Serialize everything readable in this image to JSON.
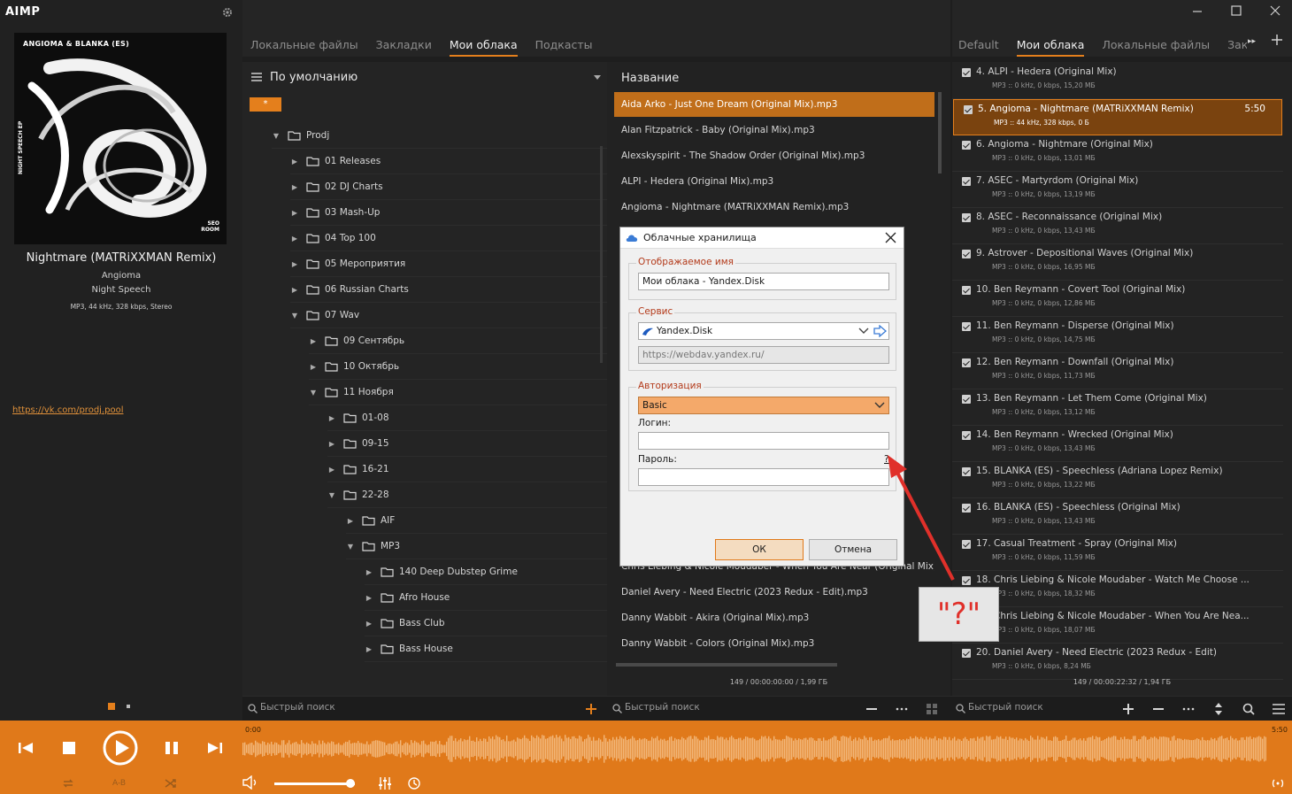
{
  "app": {
    "logo": "AIMP"
  },
  "now_playing": {
    "cover_caption": "ANGIOMA & BLANKA (ES)",
    "cover_side_text": "NIGHT SPEECH EP",
    "cover_label": "SEO ROOM",
    "title": "Nightmare (MATRiXXMAN Remix)",
    "artist": "Angioma",
    "album": "Night Speech",
    "info": "MP3, 44 kHz, 328 kbps, Stereo",
    "link": "https://vk.com/prodj.pool"
  },
  "mid_tabs": [
    "Локальные файлы",
    "Закладки",
    "Мои облака",
    "Подкасты"
  ],
  "right_tabs": [
    "Default",
    "Мои облака",
    "Локальные файлы",
    "Закл"
  ],
  "tree": {
    "header": "По умолчанию",
    "star": "*",
    "nodes": [
      {
        "label": "Prodj",
        "arrow": "▼"
      },
      {
        "label": "01 Releases",
        "arrow": "▶"
      },
      {
        "label": "02 DJ Charts",
        "arrow": "▶"
      },
      {
        "label": "03 Mash-Up",
        "arrow": "▶"
      },
      {
        "label": "04 Top 100",
        "arrow": "▶"
      },
      {
        "label": "05 Мероприятия",
        "arrow": "▶"
      },
      {
        "label": "06 Russian Charts",
        "arrow": "▶"
      },
      {
        "label": "07 Wav",
        "arrow": "▼"
      },
      {
        "label": "09 Сентябрь",
        "arrow": "▶"
      },
      {
        "label": "10 Октябрь",
        "arrow": "▶"
      },
      {
        "label": "11 Ноября",
        "arrow": "▼"
      },
      {
        "label": "01-08",
        "arrow": "▶"
      },
      {
        "label": "09-15",
        "arrow": "▶"
      },
      {
        "label": "16-21",
        "arrow": "▶"
      },
      {
        "label": "22-28",
        "arrow": "▼"
      },
      {
        "label": "AIF",
        "arrow": "▶"
      },
      {
        "label": "MP3",
        "arrow": "▼"
      },
      {
        "label": "140  Deep Dubstep  Grime",
        "arrow": "▶"
      },
      {
        "label": "Afro House",
        "arrow": "▶"
      },
      {
        "label": "Bass  Club",
        "arrow": "▶"
      },
      {
        "label": "Bass House",
        "arrow": "▶"
      }
    ]
  },
  "files": {
    "header": "Название",
    "rows": [
      "Aida Arko - Just One Dream (Original Mix).mp3",
      "Alan Fitzpatrick - Baby (Original Mix).mp3",
      "Alexskyspirit - The Shadow Order (Original Mix).mp3",
      "ALPI - Hedera (Original Mix).mp3",
      "Angioma - Nightmare (MATRiXXMAN Remix).mp3",
      "riginal",
      "Chris Liebing & Nicole Moudaber - When You Are Near (Original Mix).",
      "Daniel Avery - Need Electric (2023 Redux - Edit).mp3",
      "Danny Wabbit - Akira (Original Mix).mp3",
      "Danny Wabbit - Colors (Original Mix).mp3"
    ],
    "status": "149 / 00:00:00:00 / 1,99 ГБ"
  },
  "playlist": {
    "items": [
      {
        "title": "4. ALPI - Hedera (Original Mix)",
        "sub": "MP3 :: 0 kHz, 0 kbps, 15,20 МБ"
      },
      {
        "title": "5. Angioma - Nightmare (MATRiXXMAN Remix)",
        "sub": "MP3 :: 44 kHz, 328 kbps, 0 Б",
        "duration": "5:50"
      },
      {
        "title": "6. Angioma - Nightmare (Original Mix)",
        "sub": "MP3 :: 0 kHz, 0 kbps, 13,01 МБ"
      },
      {
        "title": "7. ASEC - Martyrdom (Original Mix)",
        "sub": "MP3 :: 0 kHz, 0 kbps, 13,19 МБ"
      },
      {
        "title": "8. ASEC - Reconnaissance (Original Mix)",
        "sub": "MP3 :: 0 kHz, 0 kbps, 13,43 МБ"
      },
      {
        "title": "9. Astrover - Depositional Waves (Original Mix)",
        "sub": "MP3 :: 0 kHz, 0 kbps, 16,95 МБ"
      },
      {
        "title": "10. Ben Reymann - Covert Tool (Original Mix)",
        "sub": "MP3 :: 0 kHz, 0 kbps, 12,86 МБ"
      },
      {
        "title": "11. Ben Reymann - Disperse (Original Mix)",
        "sub": "MP3 :: 0 kHz, 0 kbps, 14,75 МБ"
      },
      {
        "title": "12. Ben Reymann - Downfall (Original Mix)",
        "sub": "MP3 :: 0 kHz, 0 kbps, 11,73 МБ"
      },
      {
        "title": "13. Ben Reymann - Let Them Come (Original Mix)",
        "sub": "MP3 :: 0 kHz, 0 kbps, 13,12 МБ"
      },
      {
        "title": "14. Ben Reymann - Wrecked (Original Mix)",
        "sub": "MP3 :: 0 kHz, 0 kbps, 13,43 МБ"
      },
      {
        "title": "15. BLANKA (ES) - Speechless (Adriana Lopez Remix)",
        "sub": "MP3 :: 0 kHz, 0 kbps, 13,22 МБ"
      },
      {
        "title": "16. BLANKA (ES) - Speechless (Original Mix)",
        "sub": "MP3 :: 0 kHz, 0 kbps, 13,43 МБ"
      },
      {
        "title": "17. Casual Treatment - Spray (Original Mix)",
        "sub": "MP3 :: 0 kHz, 0 kbps, 11,59 МБ"
      },
      {
        "title": "18. Chris Liebing & Nicole Moudaber - Watch Me Choose ...",
        "sub": "MP3 :: 0 kHz, 0 kbps, 18,32 МБ"
      },
      {
        "title": "19. Chris Liebing & Nicole Moudaber - When You Are Nea...",
        "sub": "MP3 :: 0 kHz, 0 kbps, 18,07 МБ"
      },
      {
        "title": "20. Daniel Avery - Need Electric (2023 Redux - Edit)",
        "sub": "MP3 :: 0 kHz, 0 kbps, 8,24 МБ"
      }
    ],
    "status": "149 / 00:00:22:32 / 1,94 ГБ"
  },
  "search": {
    "placeholder": "Быстрый поиск"
  },
  "player": {
    "time_start": "0:00",
    "time_end": "5:50",
    "ab_label": "A-B",
    "volume": 0.95
  },
  "dialog": {
    "title": "Облачные хранилища",
    "display_name_label": "Отображаемое имя",
    "display_name_value": "Мои облака - Yandex.Disk",
    "service_label": "Сервис",
    "service_value": "Yandex.Disk",
    "url_value": "https://webdav.yandex.ru/",
    "auth_label": "Авторизация",
    "auth_value": "Basic",
    "login_label": "Логин:",
    "login_value": "",
    "password_label": "Пароль:",
    "password_help": "?",
    "password_value": "",
    "ok_label": "ОК",
    "cancel_label": "Отмена"
  },
  "callout": {
    "text": "\"?\""
  },
  "colors": {
    "accent": "#e0791a",
    "selected_row": "#c06e1a",
    "annotation": "#e0302a"
  }
}
